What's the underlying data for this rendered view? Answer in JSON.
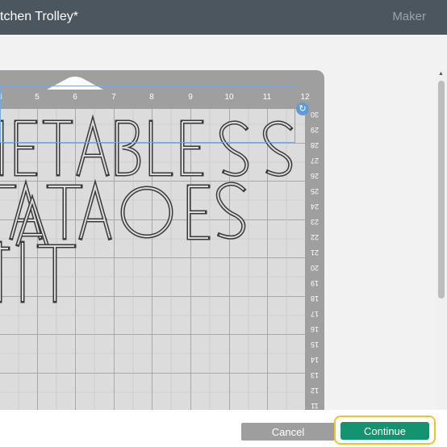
{
  "header": {
    "project_title": "tchen Trolley*",
    "machine_label": "Maker"
  },
  "mat": {
    "top_ruler": [
      "4",
      "5",
      "6",
      "7",
      "8",
      "9",
      "10",
      "11",
      "12"
    ],
    "right_ruler": [
      "30",
      "29",
      "28",
      "27",
      "26",
      "25",
      "24",
      "23",
      "22",
      "21",
      "20",
      "19",
      "18",
      "17",
      "16",
      "15",
      "14",
      "13",
      "12",
      "11"
    ],
    "rotate_icon": "rotate-icon"
  },
  "footer": {
    "cancel_label": "Cancel",
    "continue_label": "Continue"
  },
  "colors": {
    "header_bg": "#4b565f",
    "mat_frame": "#9f9f9f",
    "mat_grid": "#dcdcdc",
    "selection": "#7ea6d6",
    "continue_bg": "#13936f",
    "highlight": "#f2c12e"
  }
}
